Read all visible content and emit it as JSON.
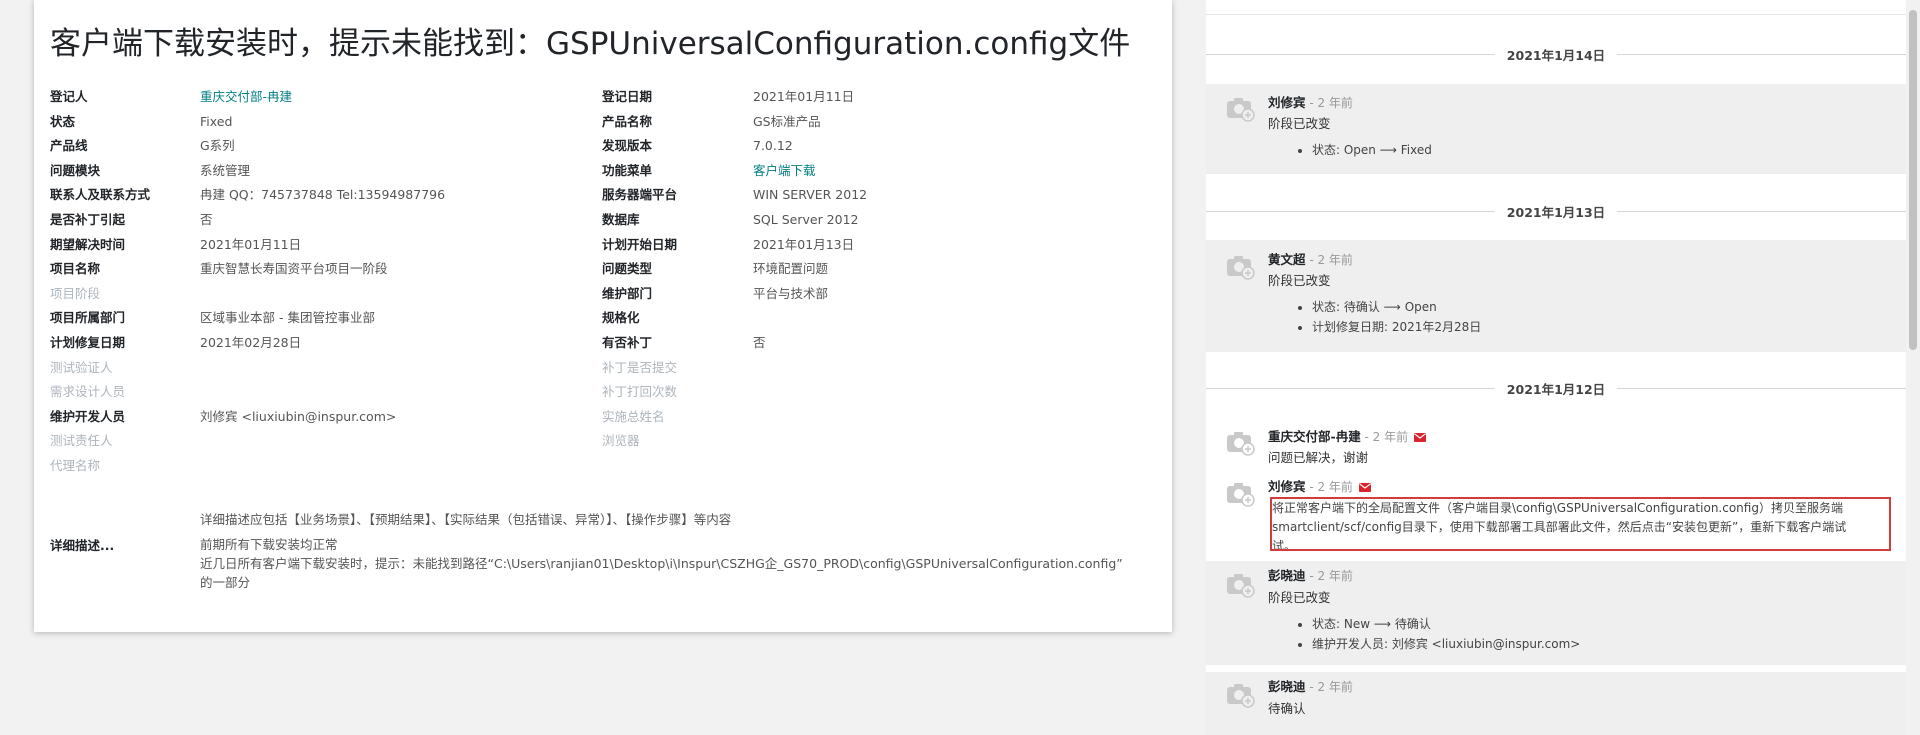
{
  "ticket": {
    "title": "客户端下载安装时，提示未能找到：GSPUniversalConfiguration.config文件",
    "fields_left": [
      {
        "label": "登记人",
        "value": "重庆交付部-冉建",
        "link": true,
        "muted": false
      },
      {
        "label": "状态",
        "value": "Fixed",
        "link": false,
        "muted": false
      },
      {
        "label": "产品线",
        "value": "G系列",
        "link": false,
        "muted": false
      },
      {
        "label": "问题模块",
        "value": "系统管理",
        "link": false,
        "muted": false
      },
      {
        "label": "联系人及联系方式",
        "value": "冉建 QQ：745737848 Tel:13594987796",
        "link": false,
        "muted": false
      },
      {
        "label": "是否补丁引起",
        "value": "否",
        "link": false,
        "muted": false
      },
      {
        "label": "期望解决时间",
        "value": "2021年01月11日",
        "link": false,
        "muted": false
      },
      {
        "label": "项目名称",
        "value": "重庆智慧长寿国资平台项目一阶段",
        "link": false,
        "muted": false
      },
      {
        "label": "项目阶段",
        "value": "",
        "link": false,
        "muted": true
      },
      {
        "label": "项目所属部门",
        "value": "区域事业本部 - 集团管控事业部",
        "link": false,
        "muted": false
      },
      {
        "label": "计划修复日期",
        "value": "2021年02月28日",
        "link": false,
        "muted": false
      },
      {
        "label": "测试验证人",
        "value": "",
        "link": false,
        "muted": true
      },
      {
        "label": "需求设计人员",
        "value": "",
        "link": false,
        "muted": true
      },
      {
        "label": "维护开发人员",
        "value": "刘修宾 <liuxiubin@inspur.com>",
        "link": false,
        "muted": false
      },
      {
        "label": "测试责任人",
        "value": "",
        "link": false,
        "muted": true
      },
      {
        "label": "代理名称",
        "value": "",
        "link": false,
        "muted": true
      }
    ],
    "fields_right": [
      {
        "label": "登记日期",
        "value": "2021年01月11日",
        "link": false,
        "muted": false
      },
      {
        "label": "产品名称",
        "value": "GS标准产品",
        "link": false,
        "muted": false
      },
      {
        "label": "发现版本",
        "value": "7.0.12",
        "link": false,
        "muted": false
      },
      {
        "label": "功能菜单",
        "value": "客户端下载",
        "link": true,
        "muted": false
      },
      {
        "label": "服务器端平台",
        "value": "WIN SERVER 2012",
        "link": false,
        "muted": false
      },
      {
        "label": "数据库",
        "value": "SQL Server 2012",
        "link": false,
        "muted": false
      },
      {
        "label": "计划开始日期",
        "value": "2021年01月13日",
        "link": false,
        "muted": false
      },
      {
        "label": "问题类型",
        "value": "环境配置问题",
        "link": false,
        "muted": false
      },
      {
        "label": "维护部门",
        "value": "平台与技术部",
        "link": false,
        "muted": false
      },
      {
        "label": "规格化",
        "value": "",
        "link": false,
        "muted": false
      },
      {
        "label": "有否补丁",
        "value": "否",
        "link": false,
        "muted": false
      },
      {
        "label": "补丁是否提交",
        "value": "",
        "link": false,
        "muted": true
      },
      {
        "label": "补丁打回次数",
        "value": "",
        "link": false,
        "muted": true
      },
      {
        "label": "实施总姓名",
        "value": "",
        "link": false,
        "muted": true
      },
      {
        "label": "浏览器",
        "value": "",
        "link": false,
        "muted": true
      }
    ],
    "description_hint": "详细描述应包括【业务场景】、【预期结果】、【实际结果（包括错误、异常）】、【操作步骤】等内容",
    "description_label": "详细描述...",
    "description_lines": [
      "前期所有下载安装均正常",
      "近几日所有客户端下载安装时，提示：未能找到路径“C:\\Users\\ranjian01\\Desktop\\i\\Inspur\\CSZHG企_GS70_PROD\\config\\GSPUniversalConfiguration.config”",
      "的一部分"
    ]
  },
  "chatter": {
    "dates": [
      "2021年1月14日",
      "2021年1月13日",
      "2021年1月12日"
    ],
    "messages": [
      {
        "author": "刘修宾",
        "ago": " - 2 年前",
        "body": "阶段已改变",
        "bullets": [
          "状态: Open ⟶ Fixed"
        ]
      },
      {
        "author": "黄文超",
        "ago": " - 2 年前",
        "body": "阶段已改变",
        "bullets": [
          "状态: 待确认 ⟶ Open",
          "计划修复日期: 2021年2月28日"
        ]
      },
      {
        "author": "重庆交付部-冉建",
        "ago": " - 2 年前",
        "body": "问题已解决，谢谢",
        "bullets": []
      },
      {
        "author": "刘修宾",
        "ago": " - 2 年前",
        "body": "",
        "bullets": [],
        "highlight_lines": [
          "将正常客户端下的全局配置文件（客户端目录\\config\\GSPUniversalConfiguration.config）拷贝至服务端",
          "smartclient/scf/config目录下，使用下载部署工具部署此文件，然后点击“安装包更新”，重新下载客户端试",
          "试。"
        ]
      },
      {
        "author": "彭晓迪",
        "ago": " - 2 年前",
        "body": "阶段已改变",
        "bullets": [
          "状态: New ⟶ 待确认",
          "维护开发人员: 刘修宾 <liuxiubin@inspur.com>"
        ]
      },
      {
        "author": "彭晓迪",
        "ago": " - 2 年前",
        "body": "待确认",
        "bullets": []
      }
    ]
  },
  "colors": {
    "link": "#017e84",
    "highlight_border": "#d43b3b",
    "mail_icon": "#d9232d"
  }
}
